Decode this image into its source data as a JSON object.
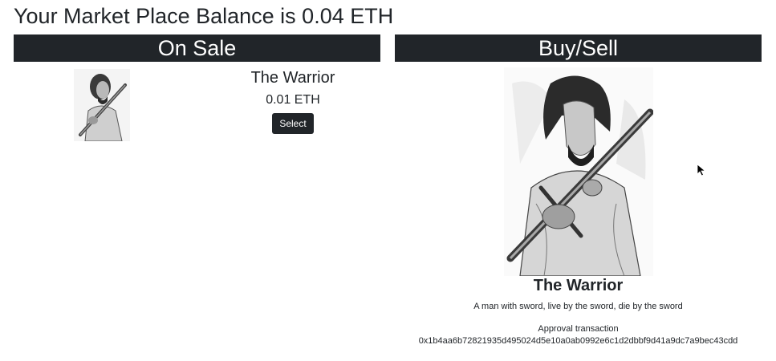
{
  "balance_text": "Your Market Place Balance is 0.04 ETH",
  "on_sale": {
    "header": "On Sale",
    "items": [
      {
        "name": "The Warrior",
        "price": "0.01 ETH",
        "button_label": "Select"
      }
    ]
  },
  "buy_sell": {
    "header": "Buy/Sell",
    "name": "The Warrior",
    "description": "A man with sword, live by the sword, die by the sword",
    "approval_label": "Approval transaction",
    "tx_hash": "0x1b4aa6b72821935d495024d5e10a0ab0992e6c1d2dbbf9d41a9dc7a9bec43cdd"
  },
  "colors": {
    "header_bg": "#212529",
    "header_text": "#ffffff",
    "button_bg": "#212529"
  },
  "icons": {
    "cursor": "mouse-pointer-icon"
  }
}
